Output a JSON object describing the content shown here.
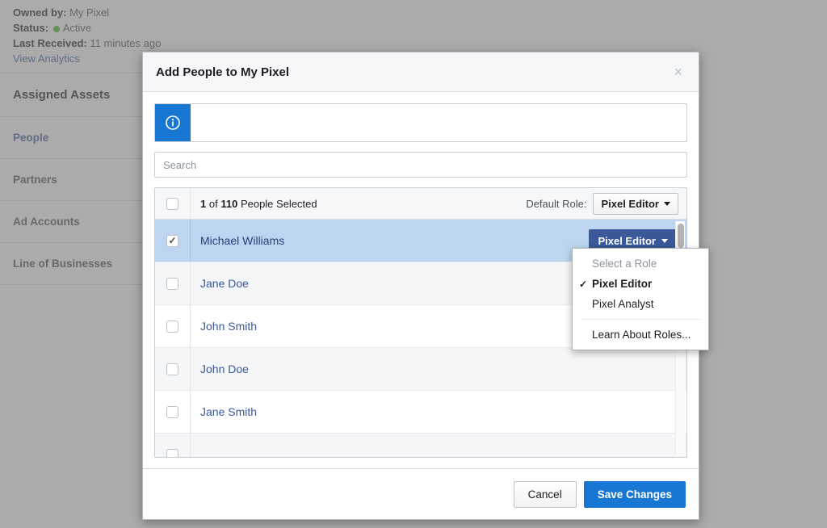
{
  "background": {
    "details": [
      {
        "label": "Owned by:",
        "value": "My Pixel"
      },
      {
        "label": "Status:",
        "value": "Active"
      },
      {
        "label": "Last Received:",
        "value": "11 minutes ago"
      }
    ],
    "analytics_link": "View Analytics",
    "section_title": "Assigned Assets",
    "nav_items": [
      {
        "label": "People",
        "active": true
      },
      {
        "label": "Partners",
        "active": false
      },
      {
        "label": "Ad Accounts",
        "active": false
      },
      {
        "label": "Line of Businesses",
        "active": false
      }
    ],
    "status_color": "#42b72a",
    "link_color": "#3b5998"
  },
  "modal": {
    "title": "Add People to My Pixel",
    "close_label": "×",
    "info_banner": {
      "icon": "info-icon",
      "text": "",
      "icon_color": "#1877d2"
    },
    "search": {
      "value": "",
      "placeholder": "Search"
    },
    "list_header": {
      "count_selected": "1",
      "count_total": "110",
      "of_text": "of",
      "suffix_text": "People Selected",
      "default_role_label": "Default Role:",
      "default_role_value": "Pixel Editor"
    },
    "people": [
      {
        "name": "Michael Williams",
        "checked": true,
        "role": "Pixel Editor"
      },
      {
        "name": "Jane Doe",
        "checked": false,
        "role": ""
      },
      {
        "name": "John Smith",
        "checked": false,
        "role": ""
      },
      {
        "name": "John Doe",
        "checked": false,
        "role": ""
      },
      {
        "name": "Jane Smith",
        "checked": false,
        "role": ""
      }
    ],
    "role_menu": {
      "items": [
        {
          "label": "Select a Role",
          "state": "disabled",
          "checked": false
        },
        {
          "label": "Pixel Editor",
          "state": "selected",
          "checked": true
        },
        {
          "label": "Pixel Analyst",
          "state": "normal",
          "checked": false
        }
      ],
      "footer_item": "Learn About Roles...",
      "check_glyph": "✓"
    },
    "footer": {
      "cancel_label": "Cancel",
      "save_label": "Save Changes",
      "primary_color": "#1877d2"
    }
  }
}
